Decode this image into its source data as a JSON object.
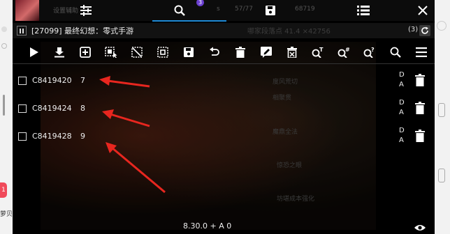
{
  "window": {
    "process_title": "[27099] 最终幻想：零式手游",
    "count": "(3)",
    "search_badge": "3"
  },
  "topbar": {
    "faint_left": "设置辅助",
    "faint_mid_a": "s",
    "faint_mid_b": "57/77",
    "faint_right": "68719"
  },
  "faint_header": "哪家段落点  41.4 ×42756",
  "icons": {
    "topbar": [
      "sliders-icon",
      "search-icon",
      "save-icon",
      "list-icon",
      "close-icon"
    ],
    "toolbar": [
      "play-icon",
      "download-icon",
      "add-icon",
      "select-all-icon",
      "deselect-icon",
      "select-range-icon",
      "save-icon",
      "undo-icon",
      "delete-icon",
      "edit-icon",
      "clear-icon",
      "search-text-icon",
      "search-hex-icon",
      "search-unknown-icon",
      "search-icon",
      "menu-icon"
    ]
  },
  "rows": [
    {
      "address": "C8419420",
      "value": "7",
      "flag_d": "D",
      "flag_a": "A"
    },
    {
      "address": "C8419424",
      "value": "8",
      "flag_d": "D",
      "flag_a": "A"
    },
    {
      "address": "C8419428",
      "value": "9",
      "flag_d": "D",
      "flag_a": "A"
    }
  ],
  "faint_bg": [
    "度风荒切",
    "相聚贯",
    "魔鼎全法",
    "惊恐之眼",
    "坊堪成本强化"
  ],
  "footer": {
    "version_label": "8.30.0 + A 0"
  },
  "left_edge": {
    "notification": "1",
    "bottom_text": "萝贝"
  },
  "colors": {
    "accent": "#1e8ad6",
    "arrow": "#e8261f",
    "badge": "#6a3fd0"
  }
}
